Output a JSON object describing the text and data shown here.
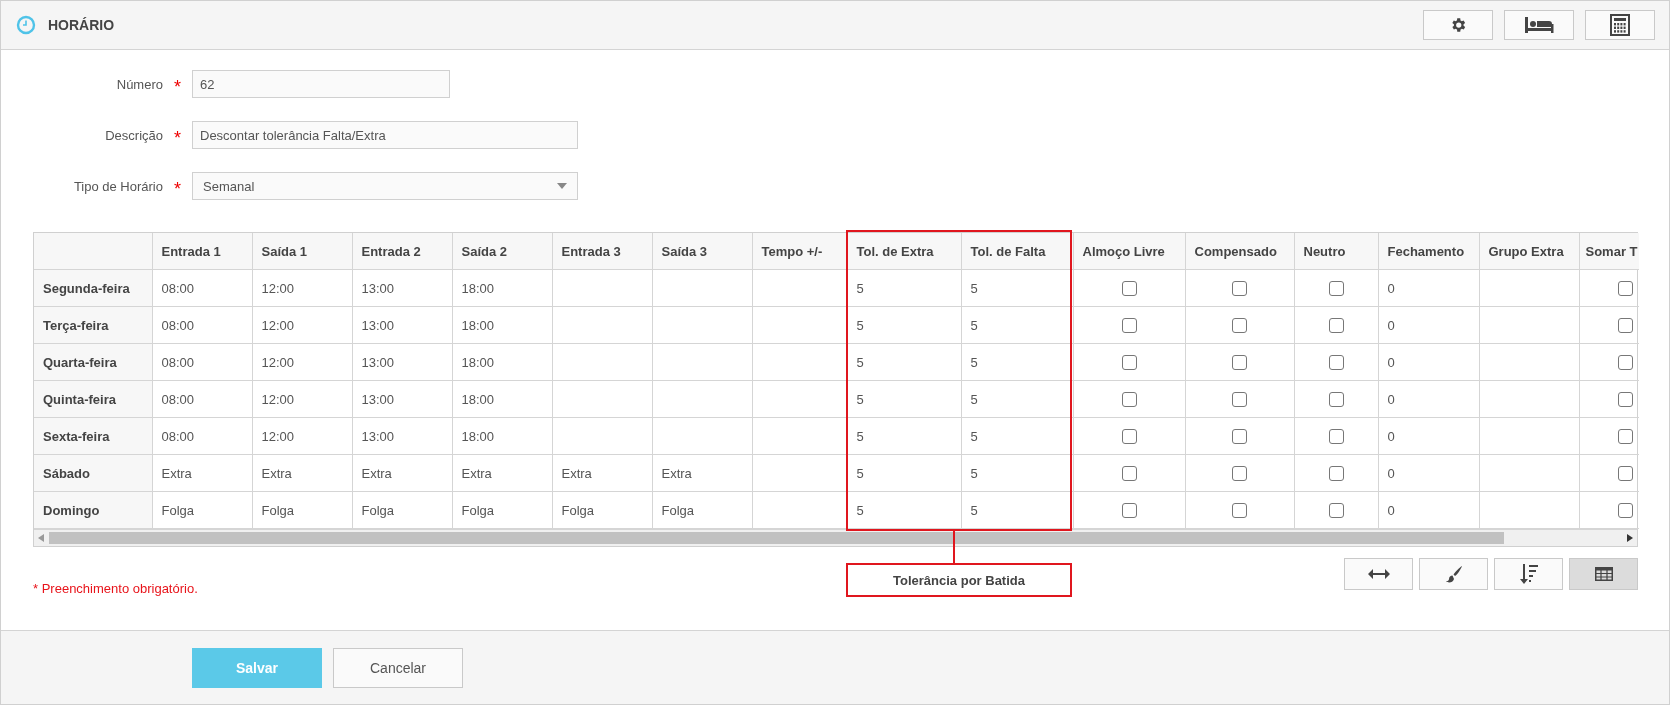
{
  "header": {
    "title": "HORÁRIO",
    "buttons": [
      {
        "kind": "gear"
      },
      {
        "kind": "bed"
      },
      {
        "kind": "calculator"
      }
    ]
  },
  "form": [
    {
      "label": "Número",
      "required_mark": "*",
      "kind": "input",
      "value": "62"
    },
    {
      "label": "Descrição",
      "required_mark": "*",
      "kind": "input",
      "value": "Descontar tolerância Falta/Extra"
    },
    {
      "label": "Tipo de Horário",
      "required_mark": "*",
      "kind": "select",
      "value": "Semanal"
    }
  ],
  "table": {
    "columns": [
      "Entrada 1",
      "Saída 1",
      "Entrada 2",
      "Saída 2",
      "Entrada 3",
      "Saída 3",
      "Tempo +/-",
      "Tol. de Extra",
      "Tol. de Falta",
      "Almoço Livre",
      "Compensado",
      "Neutro",
      "Fechamento",
      "Grupo Extra",
      "Somar T"
    ],
    "rows": [
      {
        "day": "Segunda-feira",
        "cells": [
          {
            "kind": "text",
            "text": "08:00"
          },
          {
            "kind": "text",
            "text": "12:00"
          },
          {
            "kind": "text",
            "text": "13:00"
          },
          {
            "kind": "text",
            "text": "18:00"
          },
          {
            "kind": "blank"
          },
          {
            "kind": "blank"
          },
          {
            "kind": "blank"
          },
          {
            "kind": "text",
            "text": "5"
          },
          {
            "kind": "text",
            "text": "5"
          },
          {
            "kind": "check",
            "checked": false
          },
          {
            "kind": "check",
            "checked": false
          },
          {
            "kind": "check",
            "checked": false
          },
          {
            "kind": "text",
            "text": "0"
          },
          {
            "kind": "blank"
          },
          {
            "kind": "check",
            "checked": false
          }
        ]
      },
      {
        "day": "Terça-feira",
        "cells": [
          {
            "kind": "text",
            "text": "08:00"
          },
          {
            "kind": "text",
            "text": "12:00"
          },
          {
            "kind": "text",
            "text": "13:00"
          },
          {
            "kind": "text",
            "text": "18:00"
          },
          {
            "kind": "blank"
          },
          {
            "kind": "blank"
          },
          {
            "kind": "blank"
          },
          {
            "kind": "text",
            "text": "5"
          },
          {
            "kind": "text",
            "text": "5"
          },
          {
            "kind": "check",
            "checked": false
          },
          {
            "kind": "check",
            "checked": false
          },
          {
            "kind": "check",
            "checked": false
          },
          {
            "kind": "text",
            "text": "0"
          },
          {
            "kind": "blank"
          },
          {
            "kind": "check",
            "checked": false
          }
        ]
      },
      {
        "day": "Quarta-feira",
        "cells": [
          {
            "kind": "text",
            "text": "08:00"
          },
          {
            "kind": "text",
            "text": "12:00"
          },
          {
            "kind": "text",
            "text": "13:00"
          },
          {
            "kind": "text",
            "text": "18:00"
          },
          {
            "kind": "blank"
          },
          {
            "kind": "blank"
          },
          {
            "kind": "blank"
          },
          {
            "kind": "text",
            "text": "5"
          },
          {
            "kind": "text",
            "text": "5"
          },
          {
            "kind": "check",
            "checked": false
          },
          {
            "kind": "check",
            "checked": false
          },
          {
            "kind": "check",
            "checked": false
          },
          {
            "kind": "text",
            "text": "0"
          },
          {
            "kind": "blank"
          },
          {
            "kind": "check",
            "checked": false
          }
        ]
      },
      {
        "day": "Quinta-feira",
        "cells": [
          {
            "kind": "text",
            "text": "08:00"
          },
          {
            "kind": "text",
            "text": "12:00"
          },
          {
            "kind": "text",
            "text": "13:00"
          },
          {
            "kind": "text",
            "text": "18:00"
          },
          {
            "kind": "blank"
          },
          {
            "kind": "blank"
          },
          {
            "kind": "blank"
          },
          {
            "kind": "text",
            "text": "5"
          },
          {
            "kind": "text",
            "text": "5"
          },
          {
            "kind": "check",
            "checked": false
          },
          {
            "kind": "check",
            "checked": false
          },
          {
            "kind": "check",
            "checked": false
          },
          {
            "kind": "text",
            "text": "0"
          },
          {
            "kind": "blank"
          },
          {
            "kind": "check",
            "checked": false
          }
        ]
      },
      {
        "day": "Sexta-feira",
        "cells": [
          {
            "kind": "text",
            "text": "08:00"
          },
          {
            "kind": "text",
            "text": "12:00"
          },
          {
            "kind": "text",
            "text": "13:00"
          },
          {
            "kind": "text",
            "text": "18:00"
          },
          {
            "kind": "blank"
          },
          {
            "kind": "blank"
          },
          {
            "kind": "blank"
          },
          {
            "kind": "text",
            "text": "5"
          },
          {
            "kind": "text",
            "text": "5"
          },
          {
            "kind": "check",
            "checked": false
          },
          {
            "kind": "check",
            "checked": false
          },
          {
            "kind": "check",
            "checked": false
          },
          {
            "kind": "text",
            "text": "0"
          },
          {
            "kind": "blank"
          },
          {
            "kind": "check",
            "checked": false
          }
        ]
      },
      {
        "day": "Sábado",
        "cells": [
          {
            "kind": "text",
            "text": "Extra"
          },
          {
            "kind": "text",
            "text": "Extra"
          },
          {
            "kind": "text",
            "text": "Extra"
          },
          {
            "kind": "text",
            "text": "Extra"
          },
          {
            "kind": "text",
            "text": "Extra"
          },
          {
            "kind": "text",
            "text": "Extra"
          },
          {
            "kind": "blank"
          },
          {
            "kind": "text",
            "text": "5"
          },
          {
            "kind": "text",
            "text": "5"
          },
          {
            "kind": "check",
            "checked": false
          },
          {
            "kind": "check",
            "checked": false
          },
          {
            "kind": "check",
            "checked": false
          },
          {
            "kind": "text",
            "text": "0"
          },
          {
            "kind": "blank"
          },
          {
            "kind": "check",
            "checked": false
          }
        ]
      },
      {
        "day": "Domingo",
        "cells": [
          {
            "kind": "text",
            "text": "Folga"
          },
          {
            "kind": "text",
            "text": "Folga"
          },
          {
            "kind": "text",
            "text": "Folga"
          },
          {
            "kind": "text",
            "text": "Folga"
          },
          {
            "kind": "text",
            "text": "Folga"
          },
          {
            "kind": "text",
            "text": "Folga"
          },
          {
            "kind": "blank"
          },
          {
            "kind": "text",
            "text": "5"
          },
          {
            "kind": "text",
            "text": "5"
          },
          {
            "kind": "check",
            "checked": false
          },
          {
            "kind": "check",
            "checked": false
          },
          {
            "kind": "check",
            "checked": false
          },
          {
            "kind": "text",
            "text": "0"
          },
          {
            "kind": "blank"
          },
          {
            "kind": "check",
            "checked": false
          }
        ]
      }
    ]
  },
  "annotation": {
    "label": "Tolerância por Batida"
  },
  "toolbar": [
    {
      "kind": "arrows",
      "selected": false
    },
    {
      "kind": "brush",
      "selected": false
    },
    {
      "kind": "sort",
      "selected": false
    },
    {
      "kind": "grid",
      "selected": true
    }
  ],
  "required_note": "* Preenchimento obrigatório.",
  "footer": {
    "buttons": [
      {
        "label": "Salvar",
        "kind": "primary"
      },
      {
        "label": "Cancelar",
        "kind": "secondary"
      }
    ]
  }
}
